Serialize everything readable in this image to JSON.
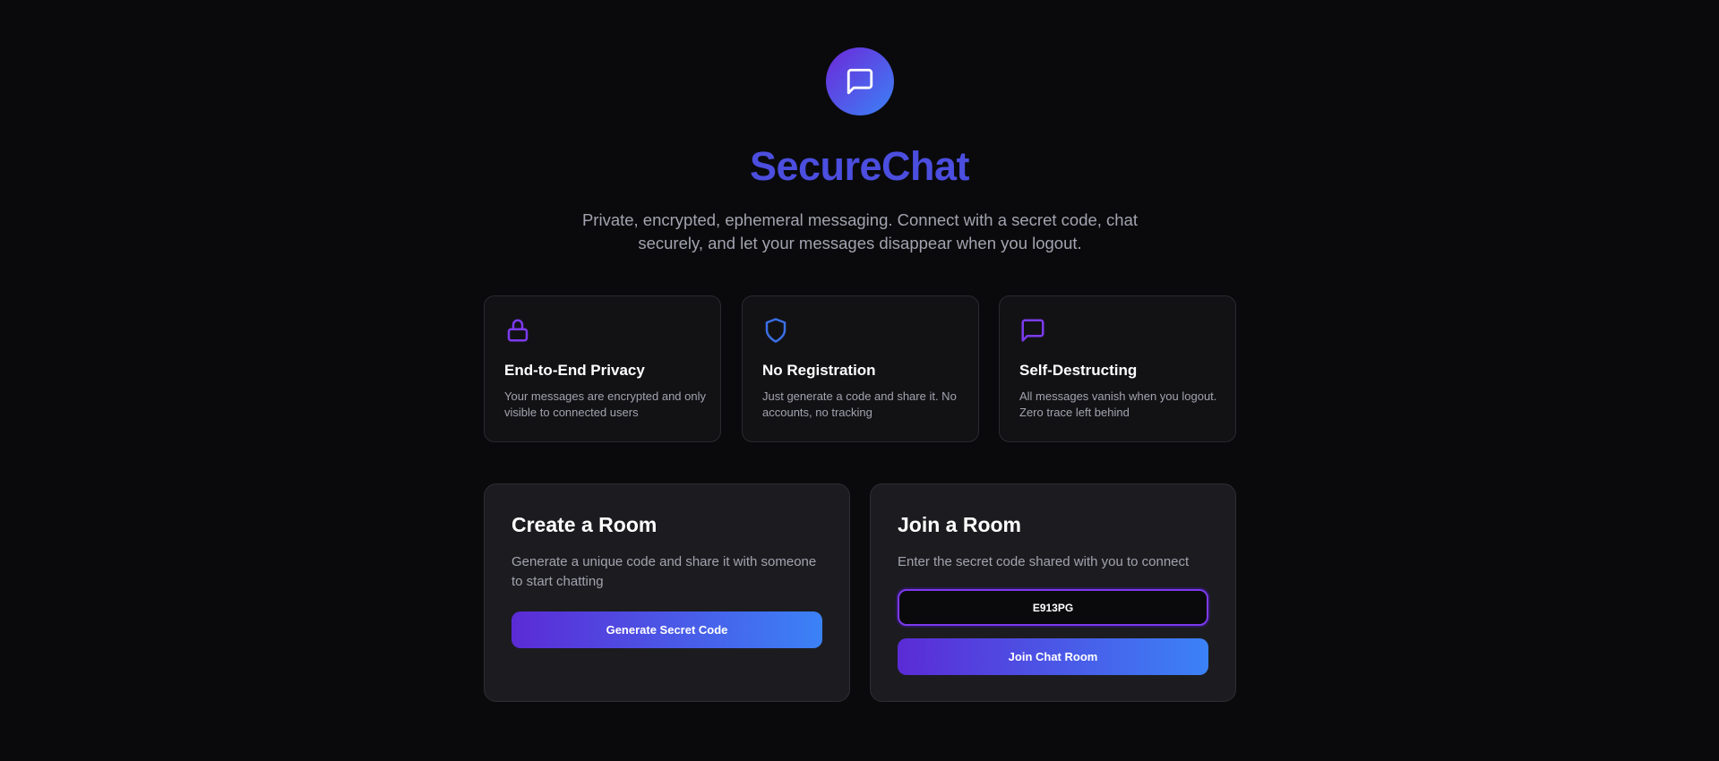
{
  "app": {
    "title": "SecureChat",
    "subtitle": "Private, encrypted, ephemeral messaging. Connect with a secret code, chat securely, and let your messages disappear when you logout.",
    "logo_icon": "chat-bubble-icon"
  },
  "features": [
    {
      "icon": "lock-icon",
      "title": "End-to-End Privacy",
      "description": "Your messages are encrypted and only visible to connected users"
    },
    {
      "icon": "shield-icon",
      "title": "No Registration",
      "description": "Just generate a code and share it. No accounts, no tracking"
    },
    {
      "icon": "chat-bubble-icon",
      "title": "Self-Destructing",
      "description": "All messages vanish when you logout. Zero trace left behind"
    }
  ],
  "create_room": {
    "title": "Create a Room",
    "description": "Generate a unique code and share it with someone to start chatting",
    "button_label": "Generate Secret Code"
  },
  "join_room": {
    "title": "Join a Room",
    "description": "Enter the secret code shared with you to connect",
    "code_value": "E913PG",
    "button_label": "Join Chat Room"
  },
  "colors": {
    "accent_purple": "#6d28d9",
    "accent_blue": "#3b82f6",
    "title": "#4b4ede",
    "background": "#0a0a0c"
  }
}
